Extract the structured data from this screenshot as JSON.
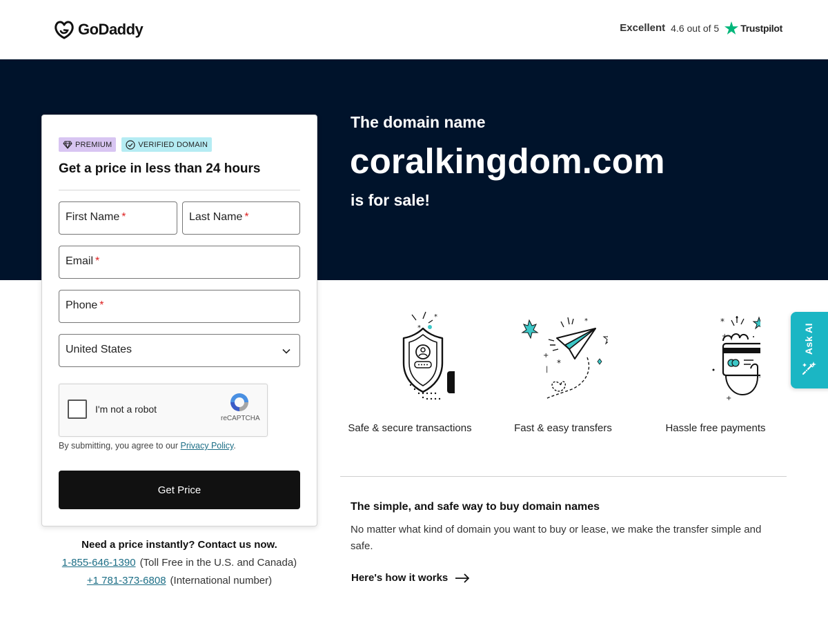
{
  "header": {
    "brand": "GoDaddy",
    "trust_rating": "Excellent",
    "trust_score": "4.6 out of 5",
    "trust_brand": "Trustpilot"
  },
  "hero": {
    "intro": "The domain name",
    "domain": "coralkingdom.com",
    "status": "is for sale!"
  },
  "form": {
    "badges": [
      "PREMIUM",
      "VERIFIED DOMAIN"
    ],
    "title": "Get a price in less than 24 hours",
    "fields": {
      "first_name": "First Name",
      "last_name": "Last Name",
      "email": "Email",
      "phone": "Phone",
      "required_marker": "*"
    },
    "country": "United States",
    "captcha": {
      "label": "I'm not a robot",
      "brand": "reCAPTCHA"
    },
    "consent_prefix": "By submitting, you agree to our",
    "consent_link": "Privacy Policy",
    "consent_suffix": ".",
    "submit_label": "Get Price"
  },
  "contact": {
    "title": "Need a price instantly? Contact us now.",
    "toll_free_number": "1-855-646-1390",
    "toll_free_note": "(Toll Free in the U.S. and Canada)",
    "intl_number": "+1 781-373-6808",
    "intl_note": "(International number)"
  },
  "features": [
    {
      "label": "Safe & secure transactions",
      "icon": "shield-icon"
    },
    {
      "label": "Fast & easy transfers",
      "icon": "paper-plane-icon"
    },
    {
      "label": "Hassle free payments",
      "icon": "card-payment-icon"
    }
  ],
  "info": {
    "title": "The simple, and safe way to buy domain names",
    "text": "No matter what kind of domain you want to buy or lease, we make the transfer simple and safe.",
    "link_label": "Here's how it works"
  },
  "ask_ai": {
    "label": "Ask AI"
  },
  "colors": {
    "hero_bg": "#00132b",
    "premium_badge": "#d8c5f2",
    "verified_badge": "#b5ecf3",
    "link": "#1b6d85",
    "ask_ai_bg": "#1bb6c4",
    "trustpilot_star": "#00b67a",
    "icon_accent": "#3cc7c7"
  }
}
